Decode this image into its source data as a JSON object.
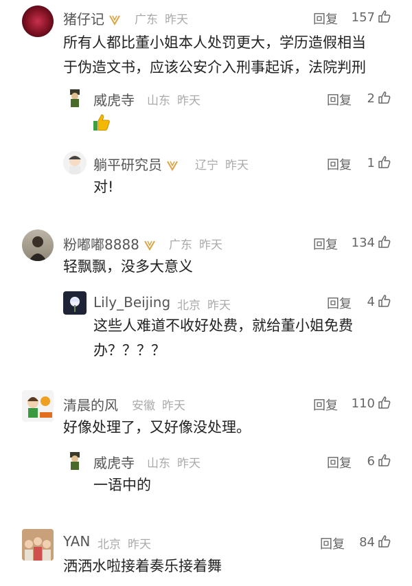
{
  "reply_label": "回复",
  "comments": [
    {
      "name": "猪仔记",
      "location": "广东",
      "time": "昨天",
      "likes": "157",
      "text_lines": [
        "所有人都比董小姐本人处罚更大，学历造假相当",
        "于伪造文书，应该公安介入刑事起诉，法院判刑"
      ],
      "replies": [
        {
          "name": "威虎寺",
          "location": "山东",
          "time": "昨天",
          "likes": "2",
          "text": "👍"
        },
        {
          "name": "躺平研究员",
          "location": "辽宁",
          "time": "昨天",
          "likes": "1",
          "text": "对!"
        }
      ]
    },
    {
      "name": "粉嘟嘟8888",
      "location": "广东",
      "time": "昨天",
      "likes": "134",
      "text_lines": [
        "轻飘飘，没多大意义"
      ],
      "replies": [
        {
          "name": "Lily_Beijing",
          "location": "北京",
          "time": "昨天",
          "likes": "4",
          "text_lines": [
            "这些人难道不收好处费，就给董小姐免费",
            "办？？？？"
          ]
        }
      ]
    },
    {
      "name": "清晨的风",
      "location": "安徽",
      "time": "昨天",
      "likes": "110",
      "text_lines": [
        "好像处理了，又好像没处理。"
      ],
      "replies": [
        {
          "name": "威虎寺",
          "location": "山东",
          "time": "昨天",
          "likes": "6",
          "text": "一语中的"
        }
      ]
    },
    {
      "name": "YAN",
      "location": "北京",
      "time": "昨天",
      "likes": "84",
      "text_lines": [
        "洒洒水啦接着奏乐接着舞"
      ]
    }
  ]
}
